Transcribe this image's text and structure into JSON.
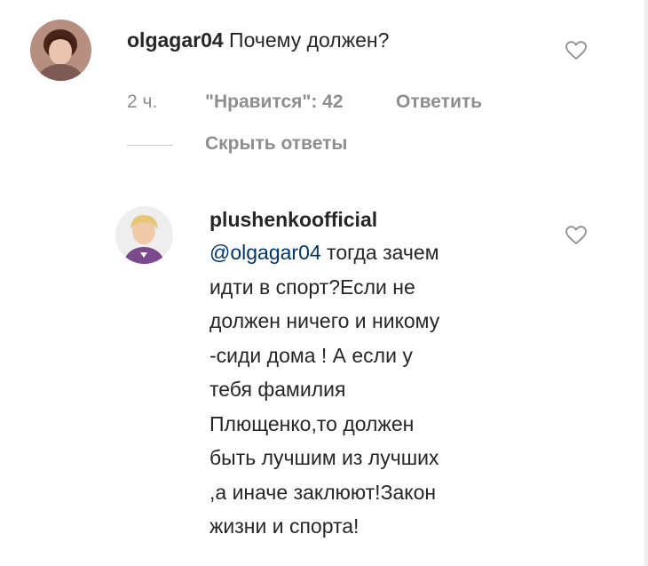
{
  "comment": {
    "username": "olgagar04",
    "text": "Почему должен?",
    "time": "2 ч.",
    "likes": "\"Нравится\": 42",
    "reply_label": "Ответить",
    "avatar_icon": "user-avatar-photo",
    "like_icon": "heart-outline"
  },
  "replies_toggle": {
    "label": "Скрыть ответы"
  },
  "reply": {
    "username": "plushenkoofficial",
    "mention": "@olgagar04",
    "lines": [
      " тогда зачем",
      "идти в спорт?Если не",
      "должен ничего и никому",
      "-сиди дома ! А если у",
      "тебя фамилия",
      "Плющенко,то должен",
      "быть лучшим из лучших",
      ",а иначе заклюют!Закон",
      "жизни и спорта!"
    ],
    "avatar_icon": "user-avatar-photo",
    "like_icon": "heart-outline"
  },
  "colors": {
    "text": "#262626",
    "meta": "#8e8e8e",
    "mention": "#00376b"
  }
}
